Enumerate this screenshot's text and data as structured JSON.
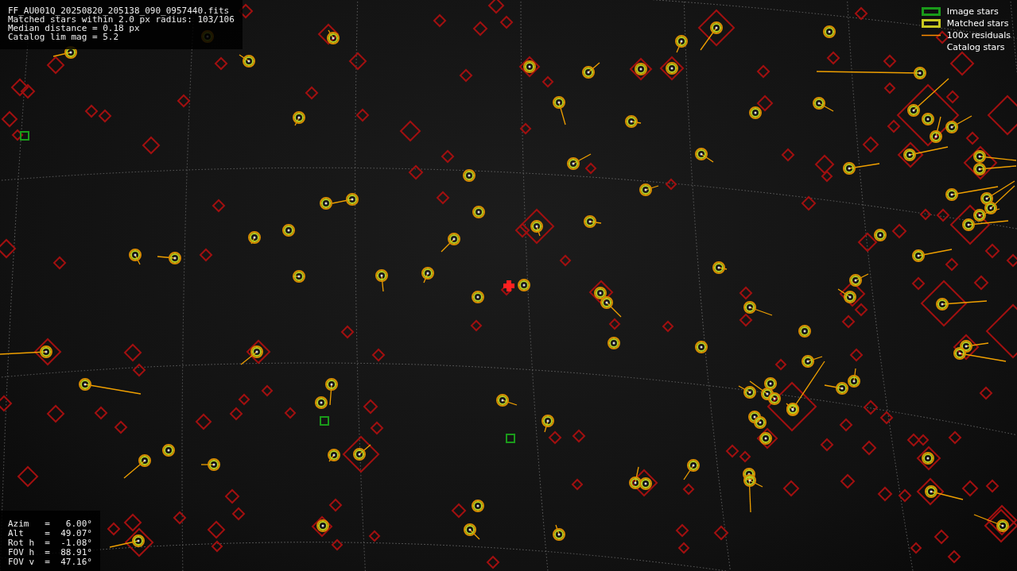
{
  "header": {
    "lines": [
      "FF_AU001Q_20250820_205138_090_0957440.fits",
      "Matched stars within 2.0 px radius: 103/106",
      "Median distance = 0.18 px",
      "Catalog lim mag = 5.2"
    ]
  },
  "legend": [
    {
      "kind": "image",
      "label": "Image stars"
    },
    {
      "kind": "matched",
      "label": "Matched stars"
    },
    {
      "kind": "residual",
      "label": "100x residuals"
    },
    {
      "kind": "catalog",
      "label": "Catalog stars"
    }
  ],
  "pointing": {
    "lines": [
      "Azim   =   6.00°",
      "Alt    =  49.07°",
      "Rot h  =  -1.08°",
      "FOV h  =  88.91°",
      "FOV v  =  47.16°"
    ]
  }
}
